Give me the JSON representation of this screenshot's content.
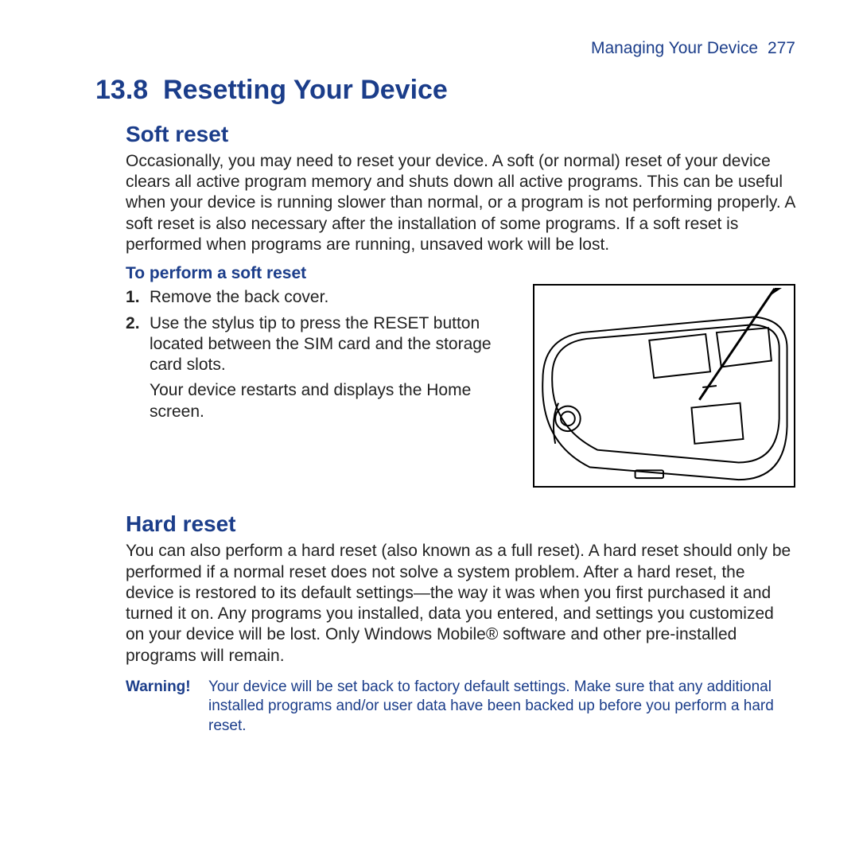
{
  "header": {
    "chapter": "Managing Your Device",
    "page_no": "277"
  },
  "section": {
    "number": "13.8",
    "title": "Resetting Your Device"
  },
  "soft_reset": {
    "heading": "Soft reset",
    "intro": "Occasionally, you may need to reset your device. A soft (or normal) reset of your device clears all active program memory and shuts down all active programs. This can be useful when your device is running slower than normal, or a program is not performing properly. A soft reset is also necessary after the installation of some programs. If a soft reset is performed when programs are running, unsaved work will be lost.",
    "procedure_heading": "To perform a soft reset",
    "steps": [
      {
        "text": "Remove the back cover."
      },
      {
        "text": "Use the stylus tip to press the RESET button located between the SIM card and the storage card slots.",
        "cont": "Your device restarts and displays the Home screen."
      }
    ]
  },
  "hard_reset": {
    "heading": "Hard reset",
    "intro": "You can also perform a hard reset (also known as a full reset). A hard reset should only be performed if a normal reset does not solve a system problem. After a hard reset, the device is restored to its default settings—the way it was when you first purchased it and turned it on. Any programs you installed, data you entered, and settings you customized on your device will be lost. Only Windows Mobile® software and other pre-installed programs will remain."
  },
  "warning": {
    "label": "Warning!",
    "text": "Your device will be set back to factory default settings. Make sure that any additional installed programs and/or user data have been backed up before you perform a hard reset."
  }
}
